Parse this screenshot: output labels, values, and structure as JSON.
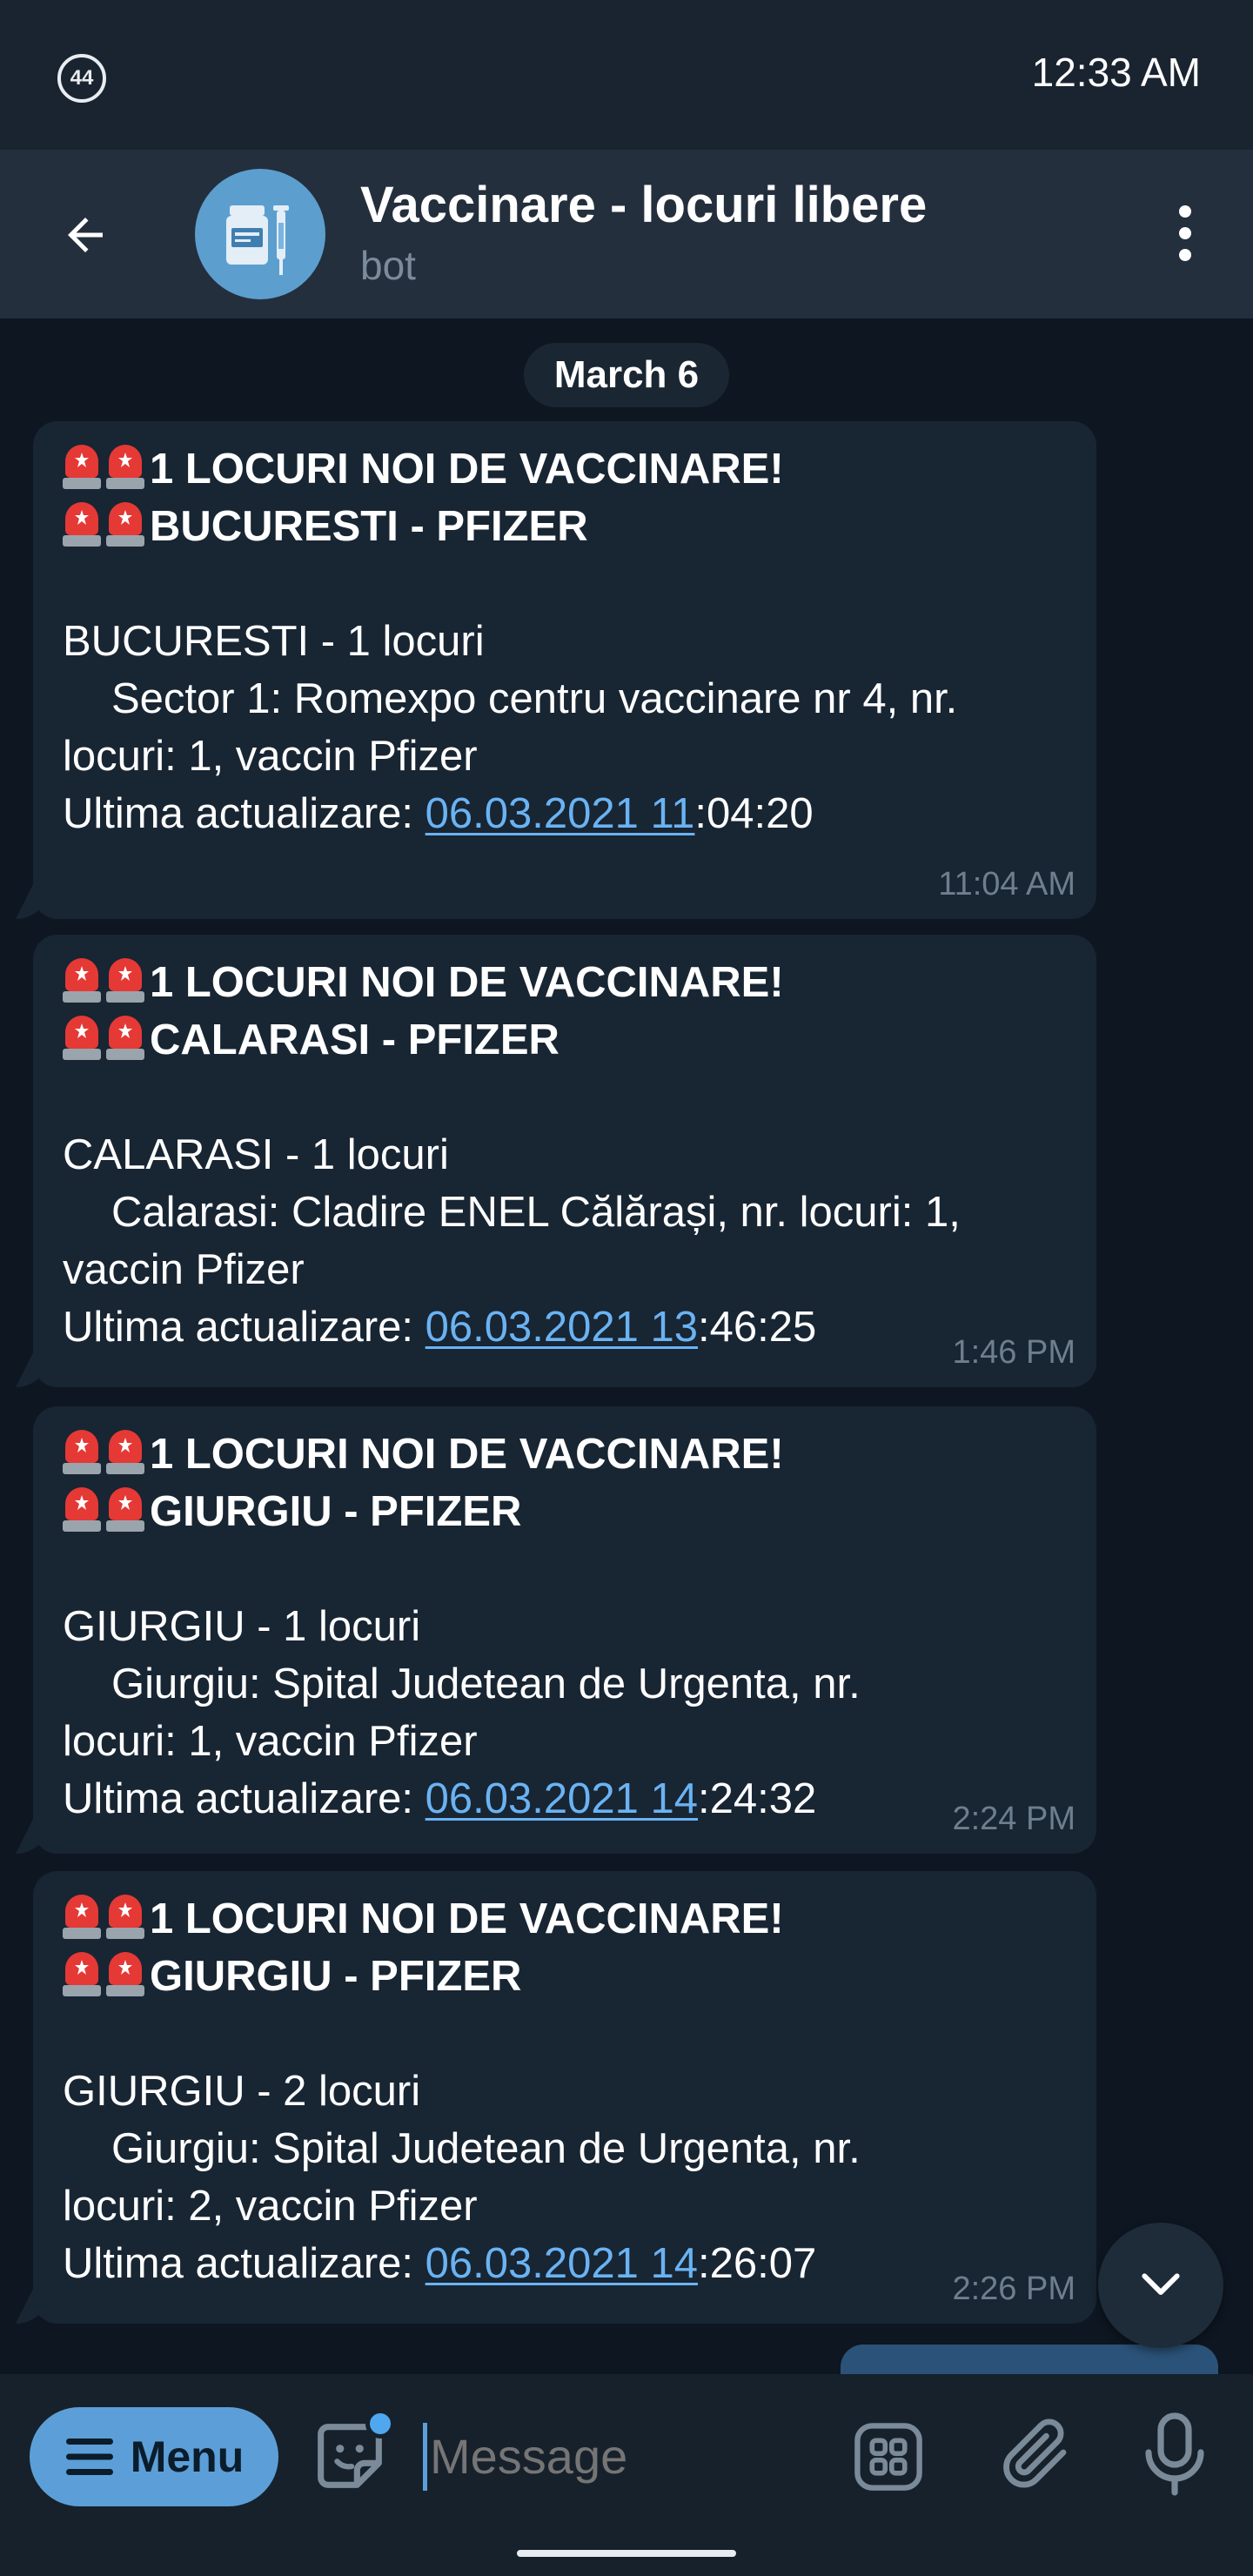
{
  "status_bar": {
    "notification_count": "44",
    "time": "12:33 AM"
  },
  "header": {
    "title": "Vaccinare - locuri libere",
    "subtitle": "bot"
  },
  "chat": {
    "date_divider": "March 6",
    "messages": [
      {
        "headline": "1 LOCURI NOI DE VACCINARE!",
        "region": "BUCURESTI - PFIZER",
        "summary": "BUCURESTI - 1 locuri",
        "detail_line1": "Sector 1: Romexpo centru vaccinare nr 4, nr.",
        "detail_line2": "locuri: 1, vaccin Pfizer",
        "updated_label": "Ultima actualizare: ",
        "updated_link": "06.03.2021 11",
        "updated_rest": ":04:20",
        "time": "11:04 AM"
      },
      {
        "headline": "1 LOCURI NOI DE VACCINARE!",
        "region": "CALARASI - PFIZER",
        "summary": "CALARASI - 1 locuri",
        "detail_line1": "Calarasi: Cladire ENEL Călărași, nr. locuri: 1,",
        "detail_line2": "vaccin Pfizer",
        "updated_label": "Ultima actualizare: ",
        "updated_link": "06.03.2021 13",
        "updated_rest": ":46:25",
        "time": "1:46 PM"
      },
      {
        "headline": "1 LOCURI NOI DE VACCINARE!",
        "region": "GIURGIU - PFIZER",
        "summary": "GIURGIU - 1 locuri",
        "detail_line1": "Giurgiu: Spital Judetean de Urgenta, nr.",
        "detail_line2": "locuri: 1, vaccin Pfizer",
        "updated_label": "Ultima actualizare: ",
        "updated_link": "06.03.2021 14",
        "updated_rest": ":24:32",
        "time": "2:24 PM"
      },
      {
        "headline": "1 LOCURI NOI DE VACCINARE!",
        "region": "GIURGIU - PFIZER",
        "summary": "GIURGIU - 2 locuri",
        "detail_line1": "Giurgiu: Spital Judetean de Urgenta, nr.",
        "detail_line2": "locuri: 2, vaccin Pfizer",
        "updated_label": "Ultima actualizare: ",
        "updated_link": "06.03.2021 14",
        "updated_rest": ":26:07",
        "time": "2:26 PM"
      }
    ]
  },
  "composer": {
    "menu_label": "Menu",
    "placeholder": "Message"
  },
  "icons": {
    "back": "arrow-left-icon",
    "more": "three-dots-vertical-icon",
    "siren": "police-light-emoji",
    "scroll_down": "chevron-down-icon",
    "menu": "hamburger-icon",
    "sticker": "sticker-smile-icon",
    "commands": "grid-icon",
    "attach": "paperclip-icon",
    "mic": "microphone-icon"
  },
  "colors": {
    "background": "#0e1621",
    "header": "#242f3d",
    "bubble": "#182533",
    "link": "#6ab3f3",
    "menu_button": "#5c9fd8",
    "siren_red": "#e53935"
  }
}
